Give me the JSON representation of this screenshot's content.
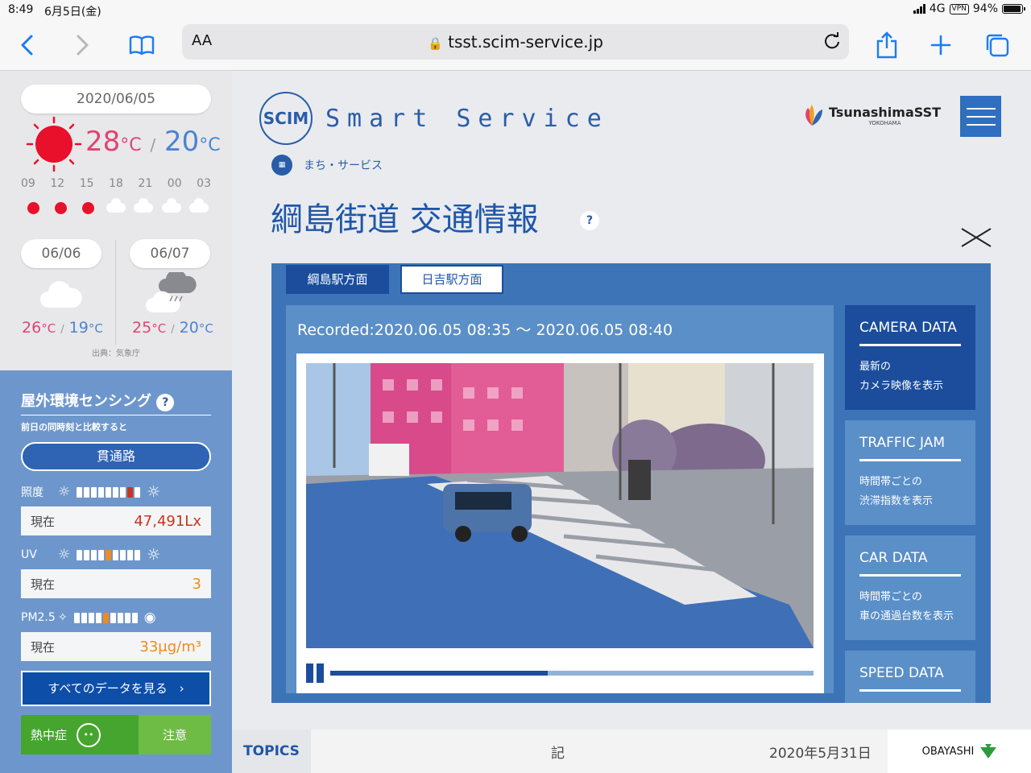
{
  "status_bar": {
    "time": "8:49",
    "date": "6月5日(金)",
    "network": "4G",
    "vpn": "VPN",
    "battery": "94%",
    "battery_level": 0.94
  },
  "browser": {
    "text_size_label": "AA",
    "url": "tsst.scim-service.jp"
  },
  "weather": {
    "today": {
      "date": "2020/06/05",
      "high": "28",
      "low": "20",
      "unit": "°C"
    },
    "hours": [
      "09",
      "12",
      "15",
      "18",
      "21",
      "00",
      "03"
    ],
    "hourly_icons": [
      "sun-dot",
      "sun-dot",
      "sun-dot",
      "cloud",
      "cloud",
      "cloud",
      "cloud"
    ],
    "forecast": [
      {
        "date": "06/06",
        "high": "26",
        "low": "19",
        "icon": "cloud-icon"
      },
      {
        "date": "06/07",
        "high": "25",
        "low": "20",
        "icon": "rain-cloud-icon"
      }
    ],
    "source": "出典：気象庁"
  },
  "sensing": {
    "title": "屋外環境センシング",
    "help": "?",
    "subtitle": "前日の同時刻と比較すると",
    "road": "貫通路",
    "now_label": "現在",
    "metrics": [
      {
        "label": "照度",
        "value": "47,491Lx",
        "color": "#c8351e",
        "level": 8,
        "segments": 9
      },
      {
        "label": "UV",
        "value": "3",
        "color": "#f08a1c",
        "level": 5,
        "segments": 9
      },
      {
        "label": "PM2.5",
        "value": "33μg/m³",
        "color": "#f08a1c",
        "level": 5,
        "segments": 9
      }
    ],
    "all_data_button": "すべてのデータを見る",
    "heatstroke": {
      "label": "熱中症",
      "level": "注意"
    }
  },
  "header": {
    "brand": "Smart Service",
    "logo_text": "SCIM",
    "partner": "TsunashimaSST",
    "partner_sub": "YOKOHAMA"
  },
  "breadcrumb": {
    "label": "まち・サービス"
  },
  "page_title": "綱島街道 交通情報",
  "help": "?",
  "tabs": [
    {
      "label": "綱島駅方面"
    },
    {
      "label": "日吉駅方面"
    }
  ],
  "video": {
    "recorded": "Recorded:2020.06.05 08:35 〜 2020.06.05 08:40",
    "progress": 0.45
  },
  "side_menu": [
    {
      "title": "CAMERA DATA",
      "desc1": "最新の",
      "desc2": "カメラ映像を表示"
    },
    {
      "title": "TRAFFIC JAM",
      "desc1": "時間帯ごとの",
      "desc2": "渋滞指数を表示"
    },
    {
      "title": "CAR DATA",
      "desc1": "時間帯ごとの",
      "desc2": "車の通過台数を表示"
    },
    {
      "title": "SPEED DATA",
      "desc1": "",
      "desc2": ""
    }
  ],
  "topics": {
    "label": "TOPICS",
    "text": "記",
    "date": "2020年5月31日",
    "sponsor": "OBAYASHI"
  },
  "colors": {
    "accent": "#1b4d9c",
    "panel": "#3d74b8",
    "title": "#1f56a8",
    "high_temp": "#e04470",
    "low_temp": "#4a84d2"
  }
}
